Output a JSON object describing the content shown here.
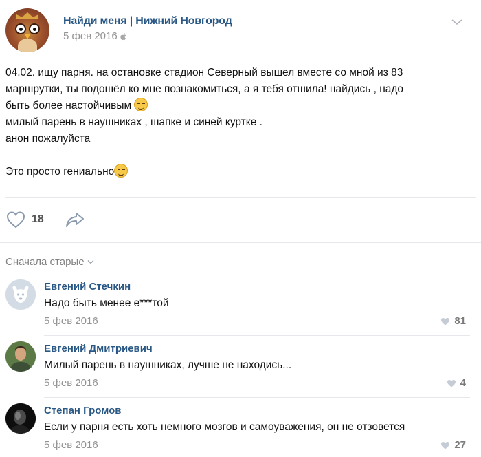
{
  "post": {
    "group_name": "Найди меня | Нижний Новгород",
    "date": "5 фев 2016",
    "lines": [
      "04.02. ищу парня. на остановке стадион Северный вышел вместе со мной из 83",
      "маршрутки, ты подошёл ко мне познакомиться, а я тебя отшила! найдись , надо",
      "быть более настойчивым",
      "милый парень в наушниках , шапке и синей куртке .",
      "анон пожалуйста",
      "________",
      "Это просто гениально"
    ],
    "likes": "18"
  },
  "comments_section": {
    "sort_label": "Сначала старые"
  },
  "comments": [
    {
      "author": "Евгений Стечкин",
      "text": "Надо быть менее е***той",
      "date": "5 фев 2016",
      "likes": "81"
    },
    {
      "author": "Евгений Дмитриевич",
      "text": "Милый парень в наушниках, лучше не находись...",
      "date": "5 фев 2016",
      "likes": "4"
    },
    {
      "author": "Степан Громов",
      "text": "Если у парня есть хоть немного мозгов и самоуважения, он не отзовется",
      "date": "5 фев 2016",
      "likes": "27"
    }
  ],
  "icons": {
    "post_menu": "chevron-down-icon",
    "platform": "apple-icon",
    "like": "heart-icon",
    "share": "share-arrow-icon",
    "emoji": "smiley-icon"
  },
  "colors": {
    "link": "#2a5885",
    "meta": "#939393",
    "divider": "#e7e8ec"
  }
}
